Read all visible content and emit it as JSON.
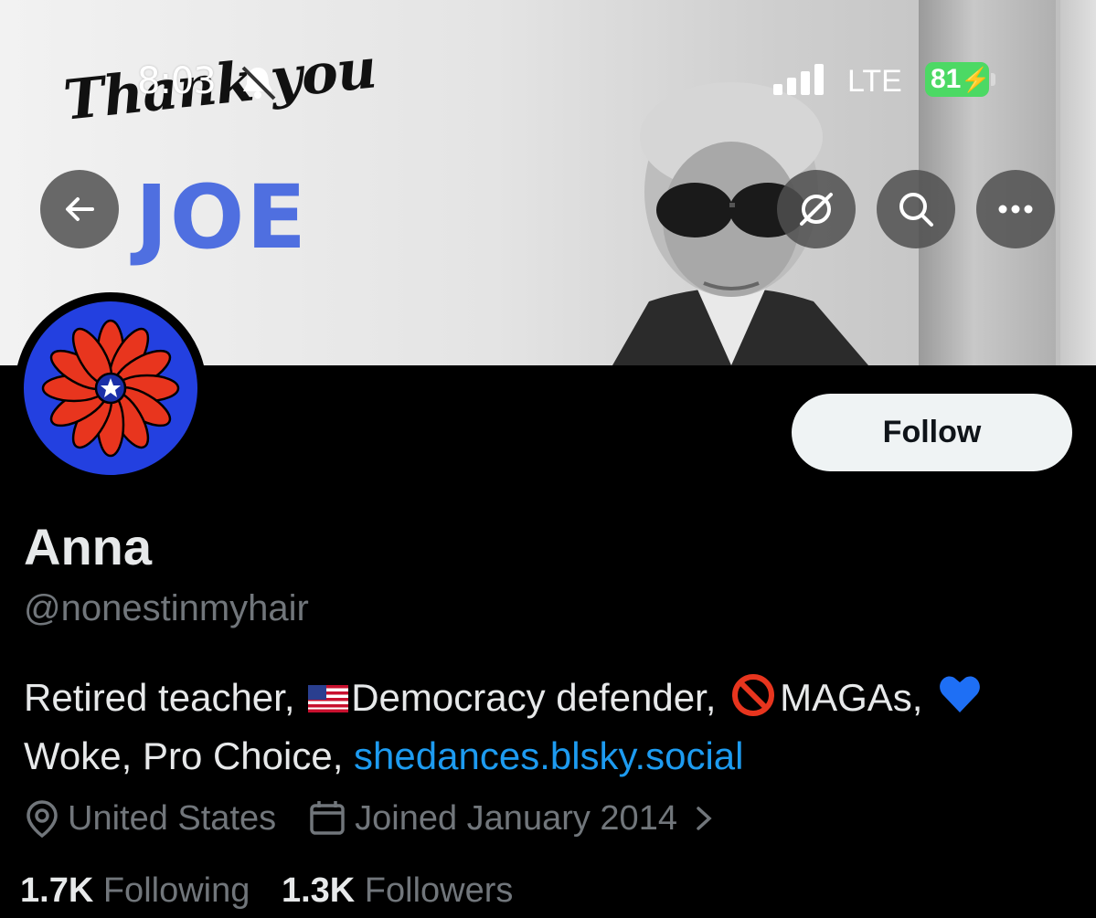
{
  "status_bar": {
    "time": "8:03",
    "network": "LTE",
    "battery": "81",
    "bell_icon": "bell-muted-icon",
    "signal_icon": "signal-icon",
    "charging_icon": "bolt-icon"
  },
  "banner": {
    "script_text": "Thank you",
    "headline": "JOE"
  },
  "header_buttons": {
    "back_icon": "arrow-left-icon",
    "grok_icon": "grok-icon",
    "search_icon": "search-icon",
    "more_icon": "more-icon"
  },
  "profile": {
    "follow_label": "Follow",
    "name": "Anna",
    "handle": "@nonestinmyhair",
    "bio_part1": "Retired teacher,",
    "bio_part2": "Democracy defender,",
    "bio_part3": "MAGAs,",
    "bio_part4": "Woke, Pro Choice,",
    "bio_link": "shedances.blsky.social",
    "location": "United States",
    "joined": "Joined January 2014",
    "following_count": "1.7K",
    "following_label": "Following",
    "followers_count": "1.3K",
    "followers_label": "Followers"
  },
  "colors": {
    "link": "#1d9bf0",
    "avatar_bg": "#2340e0",
    "flower": "#e8351e",
    "joe_text": "#4f6fe0",
    "battery": "#4cd964"
  }
}
